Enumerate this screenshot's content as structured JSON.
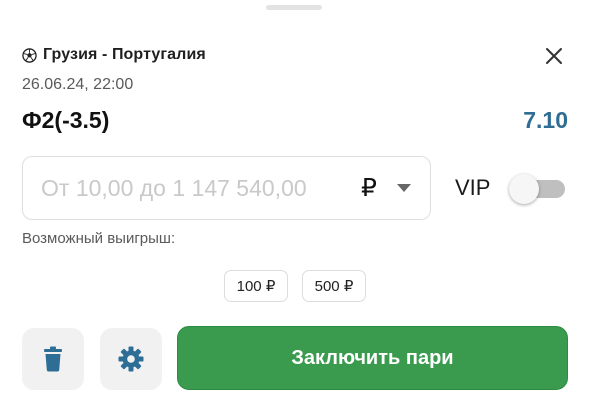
{
  "match": {
    "icon": "soccer-ball-icon",
    "title": "Грузия - Португалия",
    "datetime": "26.06.24,  22:00"
  },
  "bet": {
    "name": "Ф2(-3.5)",
    "odds": "7.10"
  },
  "stake": {
    "value": "",
    "placeholder": "От 10,00 до 1 147 540,00",
    "currency": "₽",
    "currency_dropdown_icon": "chevron-down-icon"
  },
  "vip": {
    "label": "VIP",
    "enabled": false
  },
  "possible_win_label": "Возможный выигрыш:",
  "quick_amounts": [
    "100 ₽",
    "500 ₽"
  ],
  "actions": {
    "delete_icon": "trash-icon",
    "settings_icon": "gear-icon",
    "submit_label": "Заключить пари"
  },
  "colors": {
    "accent_green": "#3a9b4f",
    "odds_blue": "#2f6d93",
    "icon_blue": "#2e6e96"
  }
}
